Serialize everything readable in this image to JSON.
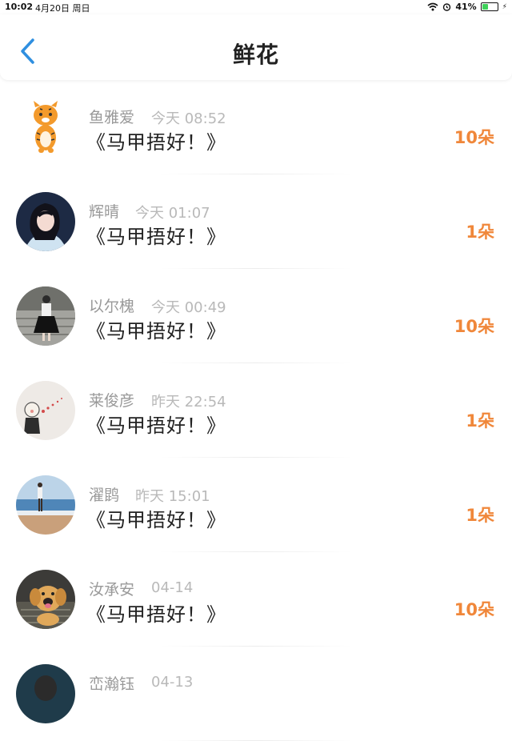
{
  "status_bar": {
    "time": "10:02",
    "date": "4月20日 周日",
    "battery_percent": "41%",
    "battery_level": 0.41
  },
  "nav": {
    "title": "鲜花"
  },
  "colors": {
    "accent_blue": "#2f8fe0",
    "count_orange": "#f0873a",
    "battery_green": "#3fd15a"
  },
  "items": [
    {
      "name": "鱼雅爱",
      "time": "今天 08:52",
      "message": "《马甲捂好！》",
      "count": "10朵",
      "avatar": "tiger-sticker-avatar"
    },
    {
      "name": "辉晴",
      "time": "今天 01:07",
      "message": "《马甲捂好！》",
      "count": "1朵",
      "avatar": "woman-portrait-avatar"
    },
    {
      "name": "以尔槐",
      "time": "今天 00:49",
      "message": "《马甲捂好！》",
      "count": "10朵",
      "avatar": "girl-standing-avatar"
    },
    {
      "name": "莱俊彦",
      "time": "昨天 22:54",
      "message": "《马甲捂好！》",
      "count": "1朵",
      "avatar": "drawing-avatar"
    },
    {
      "name": "濯鹍",
      "time": "昨天 15:01",
      "message": "《马甲捂好！》",
      "count": "1朵",
      "avatar": "beach-avatar"
    },
    {
      "name": "汝承安",
      "time": "04-14",
      "message": "《马甲捂好！》",
      "count": "10朵",
      "avatar": "puppy-avatar"
    },
    {
      "name": "峦瀚钰",
      "time": "04-13",
      "message": "",
      "count": "",
      "avatar": "partial-avatar"
    }
  ]
}
